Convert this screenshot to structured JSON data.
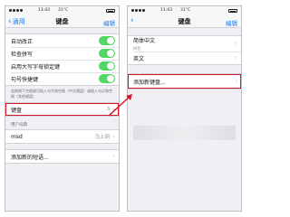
{
  "left": {
    "status": {
      "carrier": "",
      "time": "11:43",
      "temp": "31°C"
    },
    "nav": {
      "back": "通用",
      "title": "键盘",
      "right": "编辑"
    },
    "toggles": [
      {
        "label": "自动改正"
      },
      {
        "label": "检查拼写"
      },
      {
        "label": "启用大写字母锁定键"
      },
      {
        "label": "句号快捷键"
      }
    ],
    "footnote": "连按两下空格键可插入句号和空格（中文键盘）或插入句点和空格（其他键盘）",
    "keyboards_row": {
      "label": "键盘",
      "value": "3"
    },
    "user_dict_header": "用户词典",
    "shortcut_row": {
      "label": "msd",
      "value": "马上到"
    },
    "add_phrase_row": {
      "label": "添加新的短语..."
    }
  },
  "right": {
    "status": {
      "time": "11:43",
      "temp": "31°C"
    },
    "nav": {
      "back": "",
      "title": "键盘",
      "right": "编辑"
    },
    "keyboards": [
      {
        "label": "简体中文",
        "sub": "拼音"
      },
      {
        "label": "英文"
      }
    ],
    "add_keyboard_row": {
      "label": "添加新键盘..."
    }
  },
  "colors": {
    "accent": "#1a7cf2",
    "toggle_on": "#4cd964",
    "highlight": "#d0192a"
  },
  "icons": [
    "chevron-left-icon",
    "chevron-right-icon",
    "toggle-switch",
    "arrow-icon"
  ]
}
